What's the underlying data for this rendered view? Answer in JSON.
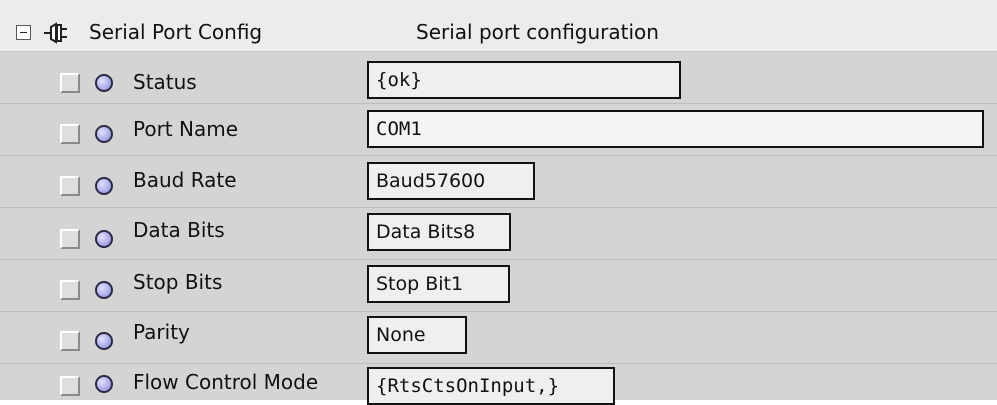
{
  "header": {
    "title": "Serial Port Config",
    "description": "Serial port configuration"
  },
  "properties": [
    {
      "label": "Status",
      "value": "{ok}"
    },
    {
      "label": "Port Name",
      "value": "COM1"
    },
    {
      "label": "Baud Rate",
      "value": "Baud57600"
    },
    {
      "label": "Data Bits",
      "value": "Data Bits8"
    },
    {
      "label": "Stop Bits",
      "value": "Stop Bit1"
    },
    {
      "label": "Parity",
      "value": "None"
    },
    {
      "label": "Flow Control Mode",
      "value": "{RtsCtsOnInput,}"
    }
  ],
  "icons": {
    "collapse": "collapse-minus-icon",
    "component": "plug-icon",
    "slot": "slot-status-dot-icon"
  },
  "colors": {
    "row_background": "#d4d4d4",
    "header_background": "#ececec",
    "field_background": "#efefef",
    "dot_fill": "#b0b0ec"
  }
}
